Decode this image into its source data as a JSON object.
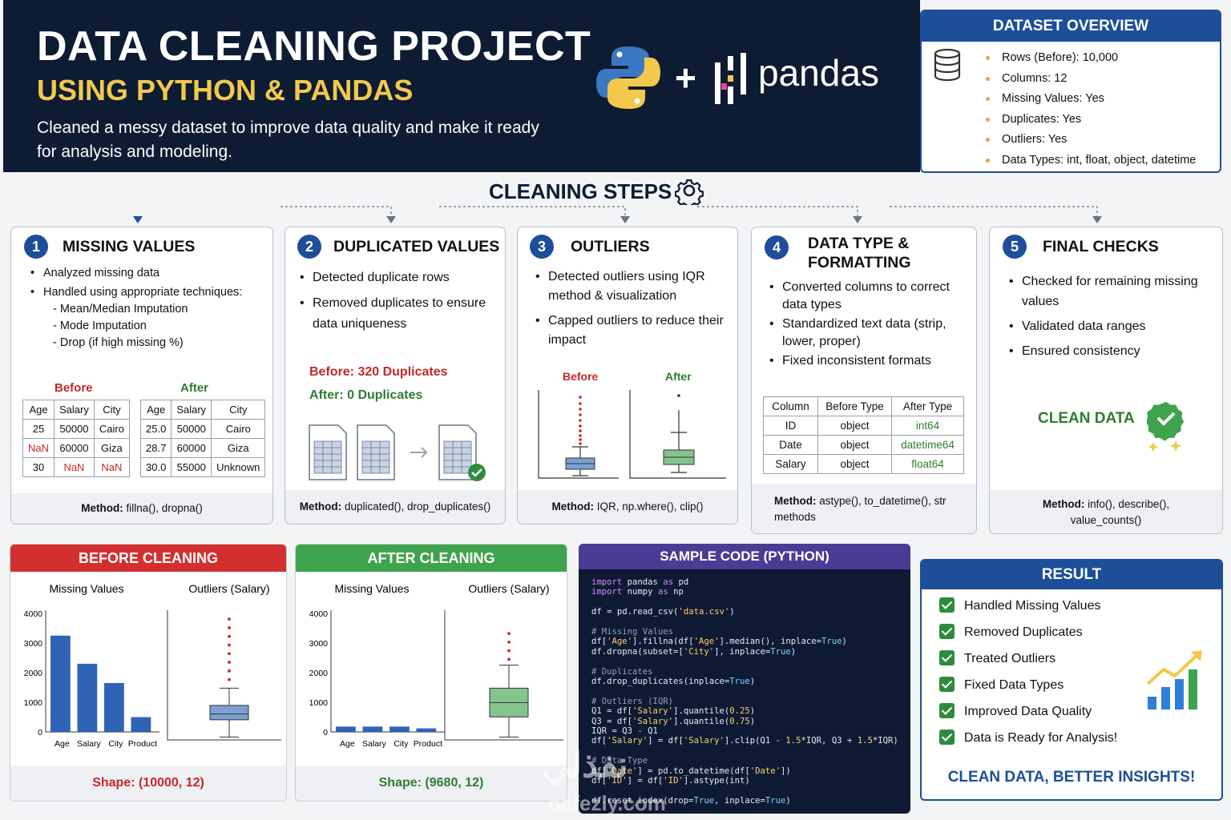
{
  "header": {
    "title": "DATA CLEANING PROJECT",
    "subtitle": "USING PYTHON & PANDAS",
    "description": "Cleaned a messy dataset to improve data quality and make it ready for analysis and modeling.",
    "plus": "+",
    "pandas_logo_text": "pandas"
  },
  "overview": {
    "title": "DATASET OVERVIEW",
    "items": [
      "Rows (Before): 10,000",
      "Columns: 12",
      "Missing Values: Yes",
      "Duplicates: Yes",
      "Outliers: Yes",
      "Data Types: int, float, object, datetime"
    ],
    "icon": "database-icon"
  },
  "steps_title": "CLEANING STEPS",
  "steps": [
    {
      "num": "1",
      "title": "MISSING VALUES",
      "bullets": [
        "Analyzed missing data",
        "Handled using appropriate techniques:"
      ],
      "sub": [
        "- Mean/Median Imputation",
        "- Mode Imputation",
        "- Drop (if high missing %)"
      ],
      "before_label": "Before",
      "after_label": "After",
      "before_table": [
        [
          "Age",
          "Salary",
          "City"
        ],
        [
          "25",
          "50000",
          "Cairo"
        ],
        [
          "NaN",
          "60000",
          "Giza"
        ],
        [
          "30",
          "NaN",
          "NaN"
        ]
      ],
      "after_table": [
        [
          "Age",
          "Salary",
          "City"
        ],
        [
          "25.0",
          "50000",
          "Cairo"
        ],
        [
          "28.7",
          "60000",
          "Giza"
        ],
        [
          "30.0",
          "55000",
          "Unknown"
        ]
      ],
      "method_label": "Method:",
      "method": "fillna(), dropna()"
    },
    {
      "num": "2",
      "title": "DUPLICATED VALUES",
      "bullets": [
        "Detected duplicate rows",
        "Removed duplicates to ensure data uniqueness"
      ],
      "before": "Before: 320 Duplicates",
      "after": "After: 0 Duplicates",
      "method_label": "Method:",
      "method": "duplicated(), drop_duplicates()"
    },
    {
      "num": "3",
      "title": "OUTLIERS",
      "bullets": [
        "Detected outliers using IQR method & visualization",
        "Capped outliers to reduce their impact"
      ],
      "before_label": "Before",
      "after_label": "After",
      "method_label": "Method:",
      "method": "IQR, np.where(), clip()"
    },
    {
      "num": "4",
      "title": "DATA TYPE & FORMATTING",
      "bullets": [
        "Converted columns to correct data types",
        "Standardized text data (strip, lower, proper)",
        "Fixed inconsistent formats"
      ],
      "table": [
        [
          "Column",
          "Before Type",
          "After Type"
        ],
        [
          "ID",
          "object",
          "int64"
        ],
        [
          "Date",
          "object",
          "datetime64"
        ],
        [
          "Salary",
          "object",
          "float64"
        ]
      ],
      "method_label": "Method:",
      "method": "astype(), to_datetime(), str methods"
    },
    {
      "num": "5",
      "title": "FINAL CHECKS",
      "bullets": [
        "Checked for remaining missing values",
        "Validated data ranges",
        "Ensured consistency"
      ],
      "badge": "CLEAN DATA",
      "method_label": "Method:",
      "method": "info(), describe(), value_counts()"
    }
  ],
  "before_panel": {
    "title": "BEFORE CLEANING",
    "shape": "Shape: (10000, 12)",
    "color": "#d32f2f"
  },
  "after_panel": {
    "title": "AFTER CLEANING",
    "shape": "Shape: (9680, 12)",
    "color": "#3fa34d"
  },
  "chart_data": [
    {
      "type": "bar",
      "title": "Missing Values",
      "categories": [
        "Age",
        "Salary",
        "City",
        "Product"
      ],
      "values": [
        3250,
        2300,
        1650,
        500
      ],
      "ylim": [
        0,
        4000
      ],
      "yticks": [
        0,
        1000,
        2000,
        3000,
        4000
      ],
      "color": "#2f63b6"
    },
    {
      "type": "box",
      "title": "Outliers (Salary)",
      "q1": 0.35,
      "median": 0.45,
      "q3": 0.6,
      "whisker_low": 0.05,
      "whisker_high": 0.9,
      "outliers": [
        1.05,
        1.2,
        1.35,
        1.5,
        1.65,
        1.8,
        1.95,
        2.1
      ],
      "color": "#7aa0d4"
    },
    {
      "type": "bar",
      "title": "Missing Values",
      "categories": [
        "Age",
        "Salary",
        "City",
        "Product"
      ],
      "values": [
        180,
        180,
        180,
        120
      ],
      "ylim": [
        0,
        4000
      ],
      "yticks": [
        0,
        1000,
        2000,
        3000,
        4000
      ],
      "color": "#2f63b6"
    },
    {
      "type": "box",
      "title": "Outliers (Salary)",
      "q1": 0.4,
      "median": 0.65,
      "q3": 0.9,
      "whisker_low": 0.05,
      "whisker_high": 1.3,
      "outliers": [
        1.4,
        1.55,
        1.7,
        1.85
      ],
      "color": "#86c48e"
    }
  ],
  "code": {
    "title": "SAMPLE CODE (PYTHON)",
    "lines": [
      "import pandas as pd",
      "import numpy as np",
      "",
      "df = pd.read_csv('data.csv')",
      "",
      "# Missing Values",
      "df['Age'].fillna(df['Age'].median(), inplace=True)",
      "df.dropna(subset=['City'], inplace=True)",
      "",
      "# Duplicates",
      "df.drop_duplicates(inplace=True)",
      "",
      "# Outliers (IQR)",
      "Q1 = df['Salary'].quantile(0.25)",
      "Q3 = df['Salary'].quantile(0.75)",
      "IQR = Q3 - Q1",
      "df['Salary'] = df['Salary'].clip(Q1 - 1.5*IQR, Q3 + 1.5*IQR)",
      "",
      "# Data Type",
      "df['Date'] = pd.to_datetime(df['Date'])",
      "df['ID'] = df['ID'].astype(int)",
      "",
      "df.reset_index(drop=True, inplace=True)"
    ]
  },
  "result": {
    "title": "RESULT",
    "items": [
      "Handled Missing Values",
      "Removed Duplicates",
      "Treated Outliers",
      "Fixed Data Types",
      "Improved Data Quality",
      "Data is Ready for Analysis!"
    ],
    "slogan": "CLEAN DATA, BETTER INSIGHTS!"
  },
  "watermark": {
    "arabic": "نفذلي",
    "latin": "nafezly.com"
  }
}
